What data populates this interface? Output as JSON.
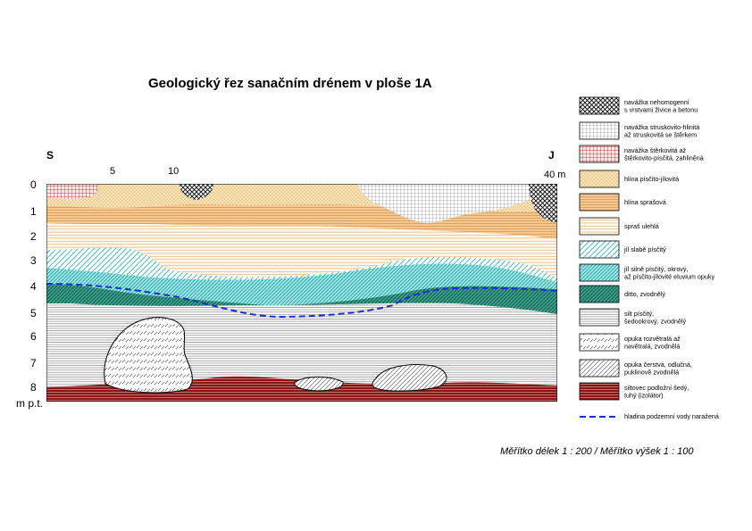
{
  "title": "Geologický řez sanačním drénem v ploše 1A",
  "direction": {
    "left": "S",
    "right": "J"
  },
  "distance_ticks": [
    "5",
    "10",
    "40 m"
  ],
  "depth_ticks": [
    "0",
    "1",
    "2",
    "3",
    "4",
    "5",
    "6",
    "7",
    "8"
  ],
  "depth_unit": "m p.t.",
  "legend": [
    {
      "pattern": "crosshatch",
      "lines": [
        "navážka nehomogenní",
        "s vrstvami živice a betonu"
      ]
    },
    {
      "pattern": "grid",
      "lines": [
        "navážka struskovito-hlinitá",
        "až struskovitá se štěrkem"
      ]
    },
    {
      "pattern": "redgrid",
      "lines": [
        "navážka štěrkovitá až",
        "štěrkovito-písčitá, zahliněná"
      ]
    },
    {
      "pattern": "dots",
      "lines": [
        "hlína písčito-jílovitá"
      ]
    },
    {
      "pattern": "hlina",
      "lines": [
        "hlína sprašová"
      ]
    },
    {
      "pattern": "spras",
      "lines": [
        "spraš ulehlá"
      ]
    },
    {
      "pattern": "jil1",
      "lines": [
        "jíl slabě písčitý"
      ]
    },
    {
      "pattern": "jil2",
      "lines": [
        "jíl silně písčitý, okrový,",
        "až písčito-jílovité eluvium opuky"
      ]
    },
    {
      "pattern": "ditto",
      "lines": [
        "ditto, zvodnělý"
      ]
    },
    {
      "pattern": "silt",
      "lines": [
        "silt písčitý,",
        "šedookrový, zvodnělý"
      ]
    },
    {
      "pattern": "opuka1",
      "lines": [
        "opuka rozvětralá až",
        "navětralá, zvodnělá"
      ]
    },
    {
      "pattern": "opuka2",
      "lines": [
        "opuka čerstvá, odlučná,",
        "puklinově zvodnělá"
      ]
    },
    {
      "pattern": "siltstone",
      "lines": [
        "siltovec podložní šedý,",
        "tuhý (izolátor)"
      ]
    },
    {
      "pattern": "water",
      "lines": [
        "hladina podzemní vody naražená"
      ]
    }
  ],
  "scale": "Měřítko délek 1 : 200 / Měřítko výšek 1 : 100"
}
